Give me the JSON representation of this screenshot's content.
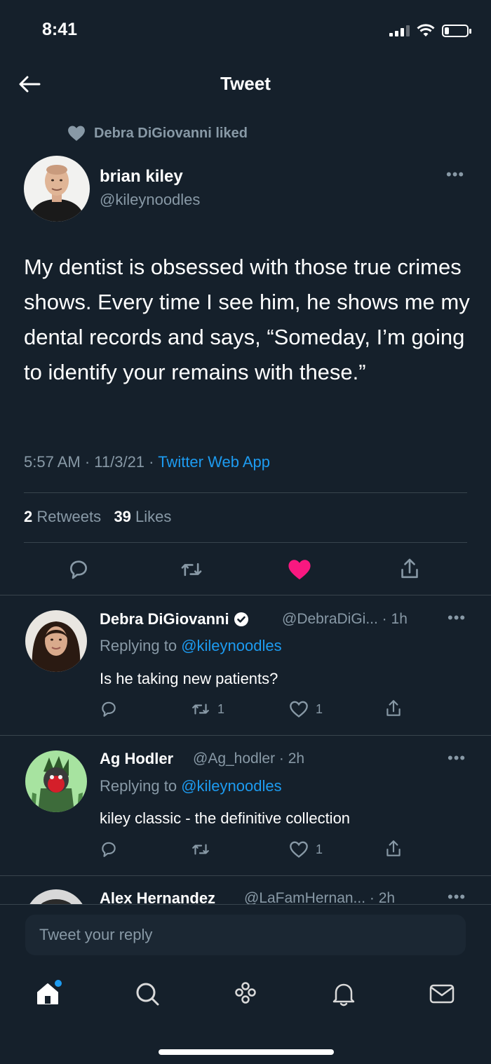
{
  "status_bar": {
    "time": "8:41"
  },
  "header": {
    "title": "Tweet"
  },
  "context": {
    "liked_by_text": "Debra DiGiovanni liked"
  },
  "tweet": {
    "author_name": "brian kiley",
    "author_handle": "@kileynoodles",
    "text": "My dentist is obsessed with those true crimes shows. Every time I see him, he shows me my dental records and says, “Someday, I’m going to identify your remains with these.”",
    "time": "5:57 AM · 11/3/21 · ",
    "source": "Twitter Web App",
    "retweets_count": "2",
    "retweets_label": "Retweets",
    "likes_count": "39",
    "likes_label": "Likes"
  },
  "replies": [
    {
      "name": "Debra DiGiovanni",
      "meta": "@DebraDiGi... · 1h",
      "replying_prefix": "Replying to ",
      "replying_to": "@kileynoodles",
      "text": "Is he taking new patients?",
      "retweets": "1",
      "likes": "1"
    },
    {
      "name": "Ag Hodler",
      "meta": "@Ag_hodler · 2h",
      "replying_prefix": "Replying to ",
      "replying_to": "@kileynoodles",
      "text": "kiley classic - the definitive collection",
      "retweets": "",
      "likes": "1"
    },
    {
      "name": "Alex Hernandez",
      "meta": "@LaFamHernan... · 2h"
    }
  ],
  "compose": {
    "placeholder": "Tweet your reply"
  },
  "colors": {
    "background": "#15202b",
    "link": "#1d9bf0",
    "like": "#f91880",
    "muted": "#8899a6"
  },
  "icons": {
    "tab_bar": [
      "home-icon",
      "search-icon",
      "spaces-icon",
      "notifications-icon",
      "messages-icon"
    ],
    "actions": [
      "reply-icon",
      "retweet-icon",
      "like-icon",
      "share-icon"
    ]
  }
}
